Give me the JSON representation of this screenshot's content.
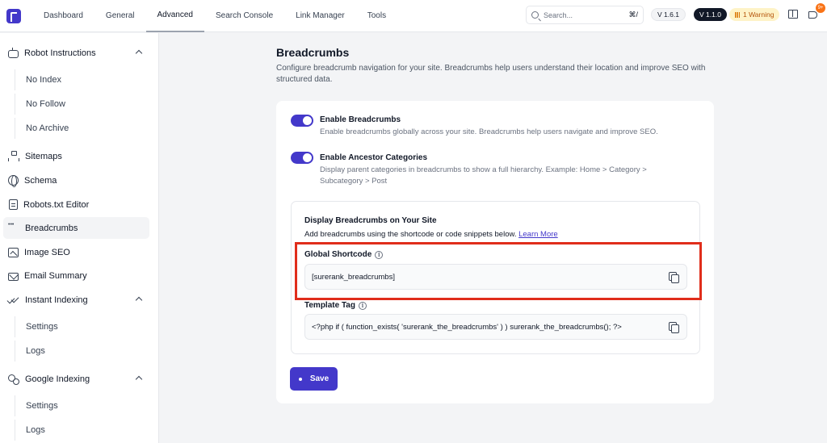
{
  "topnav": {
    "tabs": [
      {
        "label": "Dashboard"
      },
      {
        "label": "General"
      },
      {
        "label": "Advanced"
      },
      {
        "label": "Search Console"
      },
      {
        "label": "Link Manager"
      },
      {
        "label": "Tools"
      }
    ],
    "search_placeholder": "Search...",
    "search_shortcut": "⌘/",
    "version_free": "V 1.6.1",
    "version_pro": "V 1.1.0",
    "warning": "1 Warning",
    "notification_count": "9+",
    "accent_color": "#4338ca"
  },
  "sidebar": {
    "robot_instructions": "Robot Instructions",
    "robot_sub": [
      "No Index",
      "No Follow",
      "No Archive"
    ],
    "sitemaps": "Sitemaps",
    "schema": "Schema",
    "robots_txt": "Robots.txt Editor",
    "breadcrumbs": "Breadcrumbs",
    "image_seo": "Image SEO",
    "email_summary": "Email Summary",
    "instant_indexing": "Instant Indexing",
    "instant_sub": [
      "Settings",
      "Logs"
    ],
    "google_indexing": "Google Indexing",
    "google_sub": [
      "Settings",
      "Logs"
    ]
  },
  "main": {
    "title": "Breadcrumbs",
    "description": "Configure breadcrumb navigation for your site. Breadcrumbs help users understand their location and improve SEO with structured data.",
    "toggle1": {
      "label": "Enable Breadcrumbs",
      "desc": "Enable breadcrumbs globally across your site. Breadcrumbs help users navigate and improve SEO.",
      "on": true
    },
    "toggle2": {
      "label": "Enable Ancestor Categories",
      "desc": "Display parent categories in breadcrumbs to show a full hierarchy. Example: Home > Category > Subcategory > Post",
      "on": true
    },
    "display": {
      "title": "Display Breadcrumbs on Your Site",
      "subtitle": "Add breadcrumbs using the shortcode or code snippets below.",
      "learn_more": "Learn More",
      "global_label": "Global Shortcode",
      "global_value": "[surerank_breadcrumbs]",
      "template_label": "Template Tag",
      "template_value": "<?php if ( function_exists( 'surerank_the_breadcrumbs' ) ) surerank_the_breadcrumbs(); ?>"
    },
    "save_label": "Save"
  }
}
